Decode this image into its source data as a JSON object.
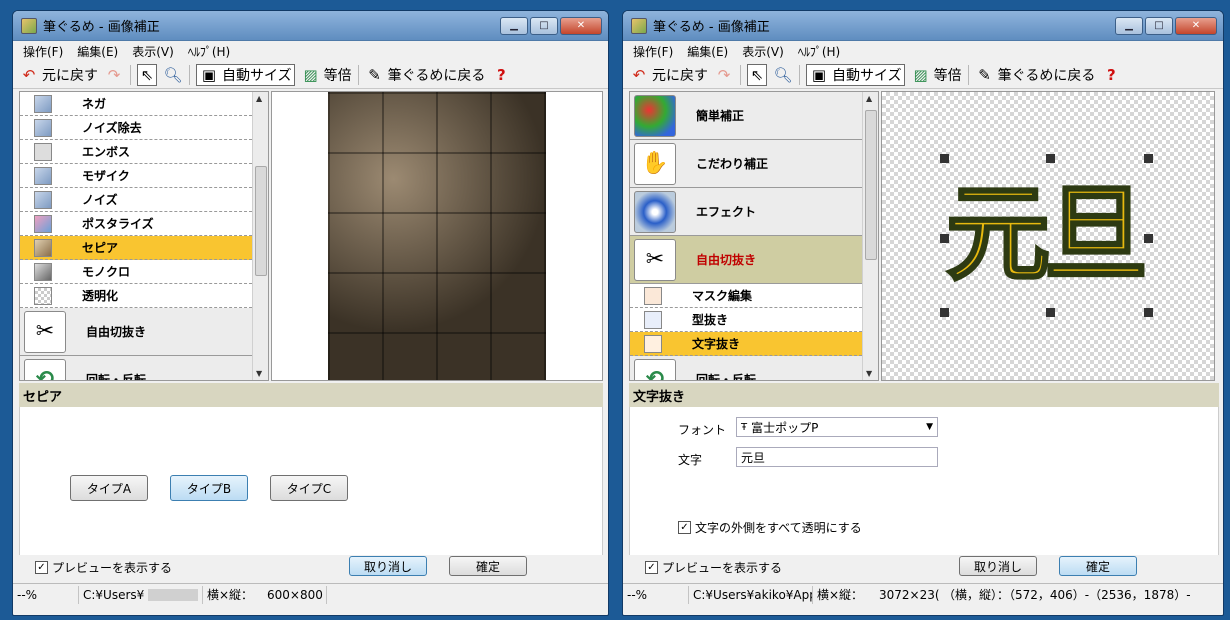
{
  "left_window": {
    "title": "筆ぐるめ - 画像補正",
    "menu": [
      "操作(F)",
      "編集(E)",
      "表示(V)",
      "ﾍﾙﾌﾟ(H)"
    ],
    "toolbar": {
      "undo": "元に戻す",
      "auto_size": "自動サイズ",
      "actual_size": "等倍",
      "back": "筆ぐるめに戻る"
    },
    "list_items": [
      {
        "label": "ネガ",
        "icon": "nega-icon"
      },
      {
        "label": "ノイズ除去",
        "icon": "denoise-icon"
      },
      {
        "label": "エンボス",
        "icon": "emboss-icon"
      },
      {
        "label": "モザイク",
        "icon": "mosaic-icon"
      },
      {
        "label": "ノイズ",
        "icon": "noise-icon"
      },
      {
        "label": "ポスタライズ",
        "icon": "posterize-icon"
      },
      {
        "label": "セピア",
        "icon": "sepia-icon",
        "selected": true
      },
      {
        "label": "モノクロ",
        "icon": "mono-icon"
      },
      {
        "label": "透明化",
        "icon": "transparent-icon"
      }
    ],
    "big_items": [
      {
        "label": "自由切抜き",
        "icon": "scissors-icon"
      },
      {
        "label": "回転・反転",
        "icon": "rotate-icon"
      }
    ],
    "section_title": "セピア",
    "type_buttons": [
      "タイプA",
      "タイプB",
      "タイプC"
    ],
    "preview_checkbox": "プレビューを表示する",
    "cancel": "取り消し",
    "ok": "確定",
    "status": {
      "zoom": "--%",
      "path": "C:¥Users¥",
      "size_label": "横×縦：",
      "size": "600×800"
    }
  },
  "right_window": {
    "title": "筆ぐるめ - 画像補正",
    "menu": [
      "操作(F)",
      "編集(E)",
      "表示(V)",
      "ﾍﾙﾌﾟ(H)"
    ],
    "toolbar": {
      "undo": "元に戻す",
      "auto_size": "自動サイズ",
      "actual_size": "等倍",
      "back": "筆ぐるめに戻る"
    },
    "big_items": [
      {
        "label": "簡単補正",
        "icon": "color-wheel-icon"
      },
      {
        "label": "こだわり補正",
        "icon": "color-hand-icon"
      },
      {
        "label": "エフェクト",
        "icon": "swirl-icon"
      },
      {
        "label": "自由切抜き",
        "icon": "scissors-icon",
        "selected": true
      }
    ],
    "sub_items": [
      {
        "label": "マスク編集",
        "icon": "mask-icon"
      },
      {
        "label": "型抜き",
        "icon": "shape-icon"
      },
      {
        "label": "文字抜き",
        "icon": "pencil-icon",
        "selected": true
      }
    ],
    "cut_item": "回転・反転",
    "preview_text": "元旦",
    "section_title": "文字抜き",
    "font_label": "フォント",
    "font_value": "富士ポップP",
    "text_label": "文字",
    "text_value": "元旦",
    "outside_checkbox": "文字の外側をすべて透明にする",
    "preview_checkbox": "プレビューを表示する",
    "cancel": "取り消し",
    "ok": "確定",
    "status": {
      "zoom": "--%",
      "path": "C:¥Users¥akiko¥App",
      "size_label": "横×縦：",
      "size": "3072×23(",
      "coords": "（横，縦）：（572，406）-（2536，1878）-"
    }
  }
}
